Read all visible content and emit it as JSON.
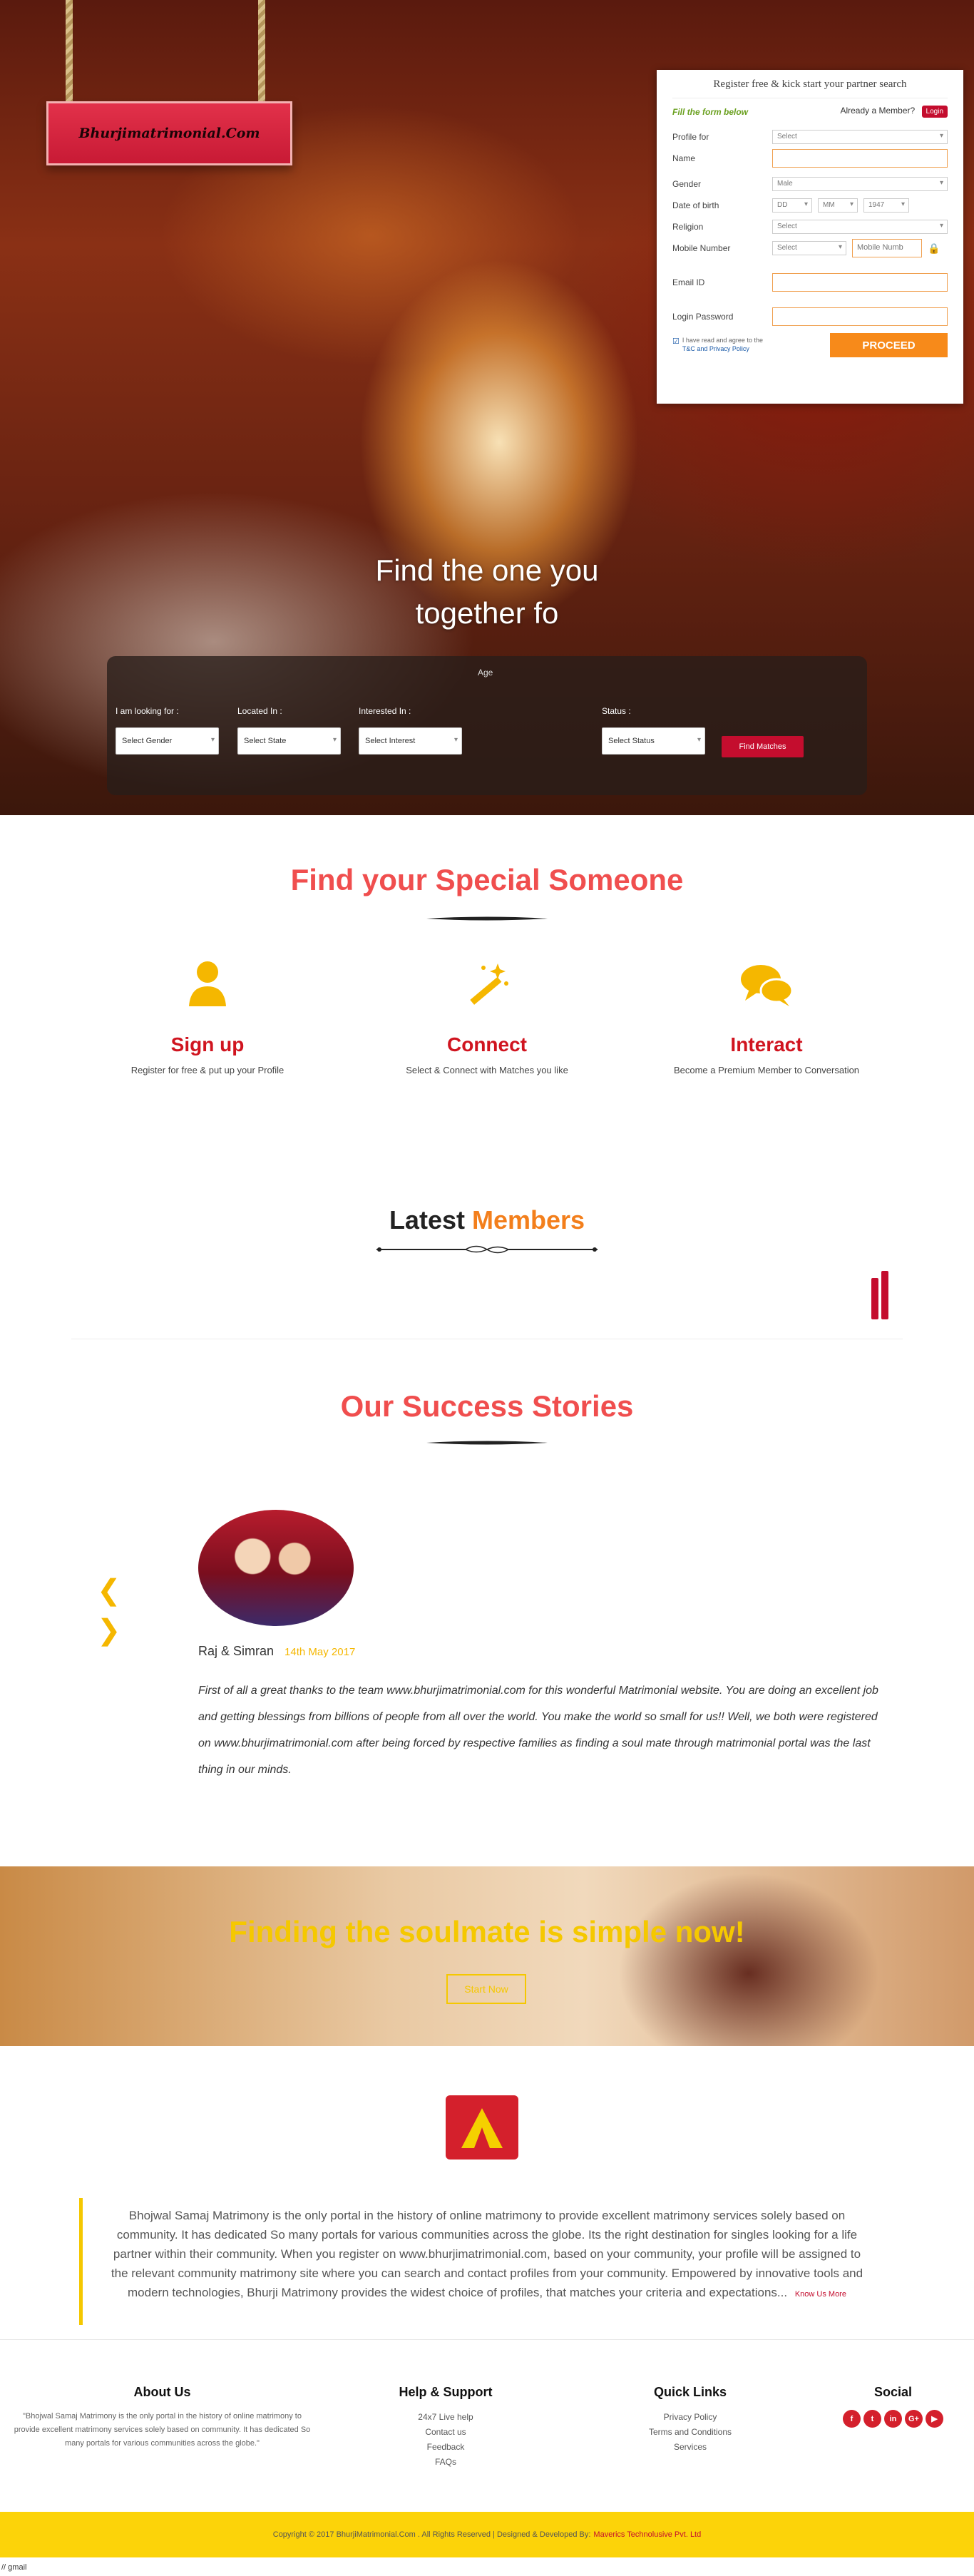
{
  "brand": {
    "logo_text": "Bhurjimatrimonial.Com"
  },
  "register": {
    "title": "Register free & kick start your partner search",
    "fill_below": "Fill the form below",
    "already_member": "Already a Member?",
    "login_label": "Login",
    "fields": {
      "profile_for": {
        "label": "Profile for",
        "value": "Select"
      },
      "name": {
        "label": "Name",
        "value": ""
      },
      "gender": {
        "label": "Gender",
        "value": "Male"
      },
      "dob": {
        "label": "Date of birth",
        "day": "DD",
        "month": "MM",
        "year": "1947"
      },
      "religion": {
        "label": "Religion",
        "value": "Select"
      },
      "mobile": {
        "label": "Mobile Number",
        "code": "Select",
        "placeholder": "Mobile Numb"
      },
      "email": {
        "label": "Email ID",
        "value": ""
      },
      "password": {
        "label": "Login Password",
        "value": ""
      }
    },
    "agree_line1": "I have read and agree to the",
    "agree_line2": "T&C and Privacy Policy",
    "proceed_label": "PROCEED"
  },
  "hero": {
    "tagline_line1": "Find the one you",
    "tagline_line2": "together fo"
  },
  "search": {
    "age_label": "Age",
    "looking_for": {
      "label": "I am looking for :",
      "value": "Select Gender"
    },
    "located_in": {
      "label": "Located In :",
      "value": "Select State"
    },
    "interested_in": {
      "label": "Interested In :",
      "value": "Select Interest"
    },
    "status": {
      "label": "Status :",
      "value": "Select Status"
    },
    "find_label": "Find Matches"
  },
  "special": {
    "title": "Find your Special Someone",
    "features": [
      {
        "title": "Sign up",
        "text": "Register for free & put up your Profile",
        "icon": "user-icon"
      },
      {
        "title": "Connect",
        "text": "Select & Connect with Matches you like",
        "icon": "magic-wand-icon"
      },
      {
        "title": "Interact",
        "text": "Become a Premium Member to Conversation",
        "icon": "chat-bubbles-icon"
      }
    ]
  },
  "latest": {
    "title_a": "Latest",
    "title_b": "Members"
  },
  "stories": {
    "title": "Our Success Stories",
    "names": "Raj & Simran",
    "date": "14th May 2017",
    "text": "First of all a great thanks to the team www.bhurjimatrimonial.com for this wonderful Matrimonial website. You are doing an excellent job and getting blessings from billions of people from all over the world. You make the world so small for us!! Well, we both were registered on www.bhurjimatrimonial.com after being forced by respective families as finding a soul mate through matrimonial portal was the last thing in our minds."
  },
  "banner": {
    "title": "Finding the soulmate is simple now!",
    "cta": "Start Now"
  },
  "about": {
    "text": "Bhojwal Samaj Matrimony is the only portal in the history of online matrimony to provide excellent matrimony services solely based on community. It has dedicated So many portals for various communities across the globe. Its the right destination for singles looking for a life partner within their community. When you register on www.bhurjimatrimonial.com, based on your community, your profile will be assigned to the relevant community matrimony site where you can search and contact profiles from your community. Empowered by innovative tools and modern technologies, Bhurji Matrimony provides the widest choice of profiles, that matches your criteria and expectations...",
    "know_more": "Know Us More"
  },
  "footer": {
    "about_title": "About Us",
    "about_text": "\"Bhojwal Samaj Matrimony is the only portal in the history of online matrimony to provide excellent matrimony services solely based on community. It has dedicated So many portals for various communities across the globe.\"",
    "help_title": "Help & Support",
    "help_links": [
      "24x7 Live help",
      "Contact us",
      "Feedback",
      "FAQs"
    ],
    "quick_title": "Quick Links",
    "quick_links": [
      "Privacy Policy",
      "Terms and Conditions",
      "Services"
    ],
    "social_title": "Social",
    "social_icons": [
      "facebook-icon",
      "twitter-icon",
      "linkedin-icon",
      "google-plus-icon",
      "youtube-icon"
    ],
    "social_glyphs": [
      "f",
      "t",
      "in",
      "G+",
      "▶"
    ],
    "copyright": "Copyright © 2017 BhurjiMatrimonial.Com . All Rights Reserved | Designed & Developed By:",
    "developer": "Maverics Technolusive Pvt. Ltd"
  },
  "bottom_note": "// gmail",
  "colors": {
    "brand_red": "#c40d2e",
    "accent_orange": "#f78a1a",
    "accent_yellow": "#f5c800",
    "title_coral": "#f04e4e"
  }
}
